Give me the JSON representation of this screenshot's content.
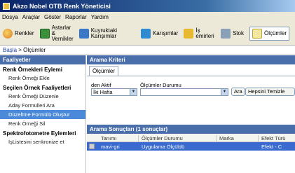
{
  "window": {
    "title": "Akzo Nobel OTB Renk Yöneticisi"
  },
  "menu": [
    "Dosya",
    "Araçlar",
    "Göster",
    "Raporlar",
    "Yardım"
  ],
  "toolbar": {
    "renkler": "Renkler",
    "astarlar_line1": "Astarlar &",
    "astarlar_line2": "Vernikler",
    "kuyruktaki": "Kuyruktaki Karışımlar",
    "karisimlar": "Karışımlar",
    "isemirleri": "İş emirleri",
    "stok": "Stok",
    "olcumler": "Ölçümler"
  },
  "breadcrumb": {
    "home": "Başla",
    "separator": " > ",
    "current": "Ölçümler"
  },
  "sidebar": {
    "header": "Faaliyetler",
    "group1": "Renk Örnekleri Eylemi",
    "g1_item1": "Renk Örneği Ekle",
    "group2": "Seçilen Örnek Faaliyetleri",
    "g2_item1": "Renk Örneği Düzenle",
    "g2_item2": "Aday Formülleri Ara",
    "g2_item3": "Düzeltme Formülü Oluştur",
    "g2_item4": "Renk Örneği Sil",
    "group3": "Spektrofotometre Eylemleri",
    "g3_item1": "İşListesini senkronize et"
  },
  "search": {
    "header": "Arama Kriteri",
    "tab": "Ölçümler",
    "date_label": "den Aktif",
    "date_value": "İki Hafta",
    "status_label": "Ölçümler Durumu",
    "status_value": "",
    "search_button": "Ara",
    "clear_button": "Hepsini Temizle"
  },
  "results": {
    "header": "Arama Sonuçları   (1 sonuçlar)",
    "columns": [
      "Tanımı",
      "Ölçümler Durumu",
      "Marka",
      "Efekt Türü"
    ],
    "rows": [
      {
        "tanimi": "mavi-gri",
        "durum": "Uygulama Ölçüldü",
        "marka": "",
        "efekt": "Efekt - C"
      }
    ]
  },
  "colors": {
    "header_blue": "#4a6ea9",
    "selected_row": "#3a6ad0"
  }
}
